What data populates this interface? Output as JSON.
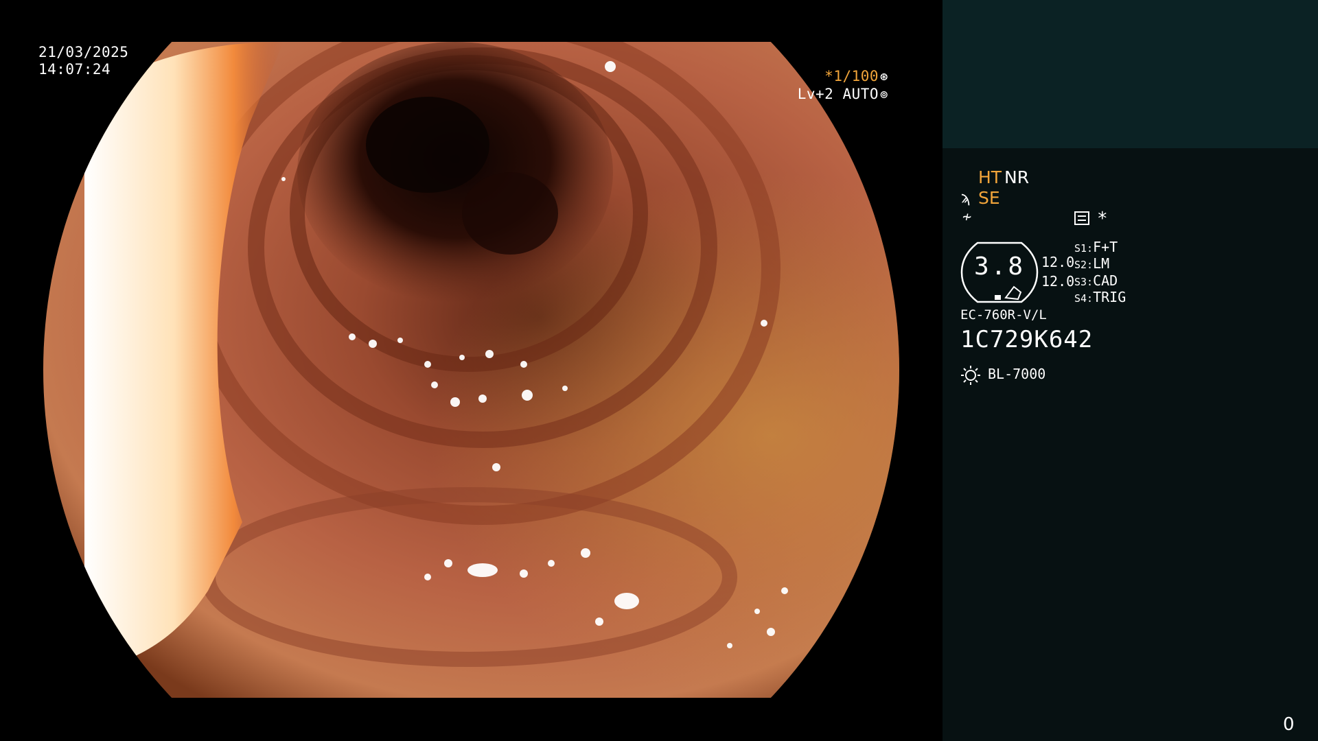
{
  "video": {
    "date": "21/03/2025",
    "time": "14:07:24",
    "shutter_prefix": "*",
    "shutter_value": "1/100",
    "shutter_icon": "aperture-icon",
    "iris": "Lv+2 AUTO",
    "iris_icon": "iris-icon"
  },
  "panel": {
    "enhancement": {
      "ht": "HT",
      "nr": "NR"
    },
    "structure_enhancement": "SE",
    "structure_icon": "structure-enhancement-icon",
    "zoom_icon": "zoom-icon",
    "setting_icon": "settings-list-icon",
    "asterisk": "*",
    "dial_value": "3.8",
    "values": [
      "12.0",
      "12.0"
    ],
    "slots": [
      {
        "key": "S1:",
        "label": "F+T"
      },
      {
        "key": "S2:",
        "label": "LM"
      },
      {
        "key": "S3:",
        "label": "CAD"
      },
      {
        "key": "S4:",
        "label": "TRIG"
      }
    ],
    "scope_model": "EC-760R-V/L",
    "scope_serial": "1C729K642",
    "light_icon": "light-source-icon",
    "light_source": "BL-7000",
    "counter": "0"
  },
  "colors": {
    "accent_orange": "#f2a53a",
    "panel_top": "#0b2224",
    "panel_bg": "#071112",
    "text": "#ffffff"
  }
}
